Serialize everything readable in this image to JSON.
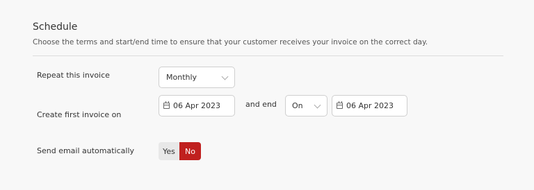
{
  "schedule": {
    "title": "Schedule",
    "subtitle": "Choose the terms and start/end time to ensure that your customer receives your invoice on the correct day."
  },
  "repeat": {
    "label": "Repeat this invoice",
    "value": "Monthly"
  },
  "first_invoice": {
    "label": "Create first invoice on",
    "start_date": "06 Apr 2023",
    "and_end_label": "and end",
    "end_mode": "On",
    "end_date": "06 Apr 2023"
  },
  "send_email": {
    "label": "Send email automatically",
    "yes_label": "Yes",
    "no_label": "No",
    "selected": "No",
    "accent_color": "#c0201f"
  }
}
